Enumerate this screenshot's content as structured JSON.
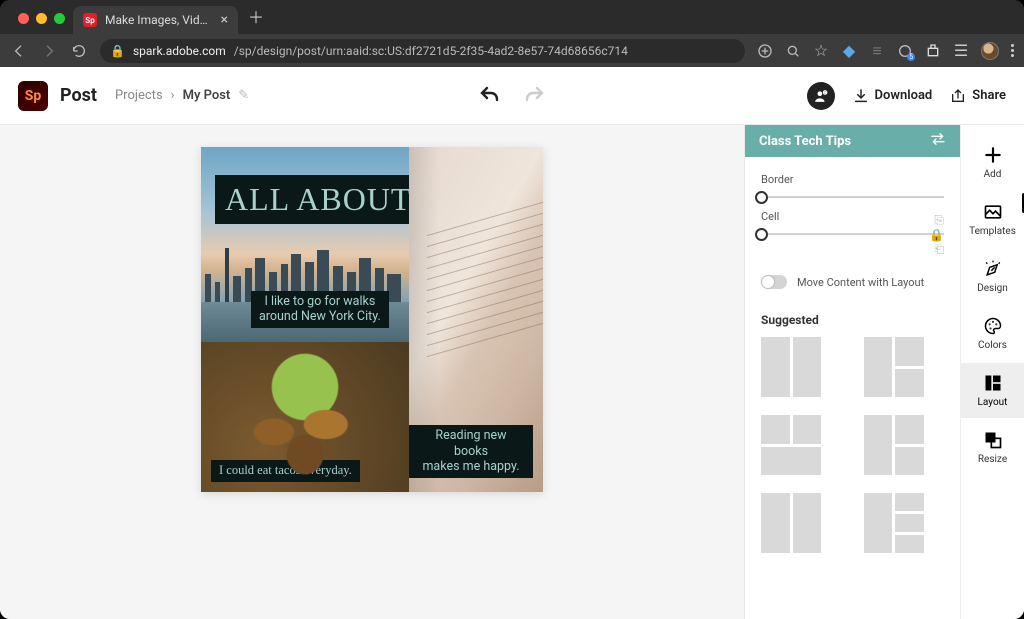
{
  "browser": {
    "tab_title": "Make Images, Videos and Web",
    "url_host": "spark.adobe.com",
    "url_path": "/sp/design/post/urn:aaid:sc:US:df2721d5-2f35-4ad2-8e57-74d68656c714"
  },
  "topbar": {
    "logo_text": "Sp",
    "brand": "Post",
    "crumb_projects": "Projects",
    "crumb_current": "My Post",
    "download": "Download",
    "share": "Share"
  },
  "canvas": {
    "title": "ALL ABOUT ME!",
    "city_caption_line1": "I like to go for walks",
    "city_caption_line2": "around New York City.",
    "taco_caption": "I could eat tacos everyday.",
    "book_caption_line1": "Reading new books",
    "book_caption_line2": "makes me happy."
  },
  "sidepanel": {
    "header": "Class Tech Tips",
    "border_label": "Border",
    "cell_label": "Cell",
    "toggle_label": "Move Content with Layout",
    "suggested": "Suggested"
  },
  "rail": {
    "add": "Add",
    "templates": "Templates",
    "design": "Design",
    "colors": "Colors",
    "layout": "Layout",
    "resize": "Resize"
  }
}
